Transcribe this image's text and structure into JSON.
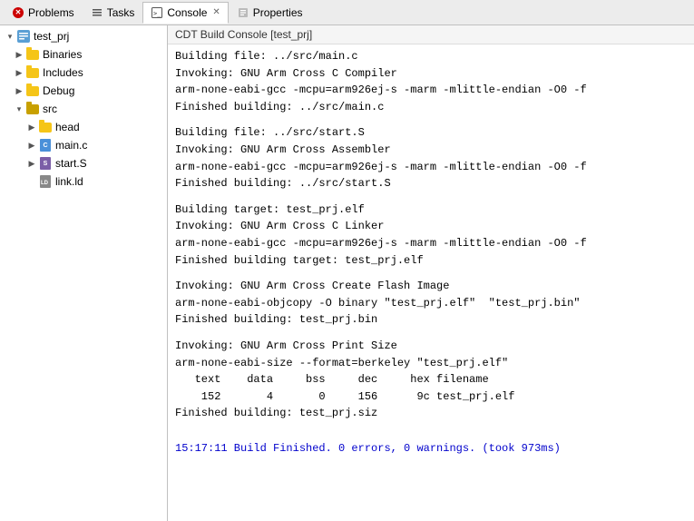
{
  "tabs": [
    {
      "id": "problems",
      "label": "Problems",
      "icon": "problems-icon",
      "active": false,
      "closable": false
    },
    {
      "id": "tasks",
      "label": "Tasks",
      "icon": "tasks-icon",
      "active": false,
      "closable": false
    },
    {
      "id": "console",
      "label": "Console",
      "icon": "console-icon",
      "active": true,
      "closable": true
    },
    {
      "id": "properties",
      "label": "Properties",
      "icon": "props-icon",
      "active": false,
      "closable": false
    }
  ],
  "console_header": "CDT Build Console [test_prj]",
  "sidebar": {
    "tree": [
      {
        "id": "test_prj",
        "label": "test_prj",
        "icon": "project",
        "indent": 0,
        "expanded": true,
        "arrow": "▾"
      },
      {
        "id": "binaries",
        "label": "Binaries",
        "icon": "folder",
        "indent": 1,
        "expanded": false,
        "arrow": "▶"
      },
      {
        "id": "includes",
        "label": "Includes",
        "icon": "folder",
        "indent": 1,
        "expanded": false,
        "arrow": "▶"
      },
      {
        "id": "debug",
        "label": "Debug",
        "icon": "folder",
        "indent": 1,
        "expanded": false,
        "arrow": "▶"
      },
      {
        "id": "src",
        "label": "src",
        "icon": "folder-src",
        "indent": 1,
        "expanded": true,
        "arrow": "▾"
      },
      {
        "id": "head",
        "label": "head",
        "icon": "folder",
        "indent": 2,
        "expanded": false,
        "arrow": "▶"
      },
      {
        "id": "main_c",
        "label": "main.c",
        "icon": "c-file",
        "indent": 2,
        "expanded": false,
        "arrow": "▶"
      },
      {
        "id": "start_s",
        "label": "start.S",
        "icon": "s-file",
        "indent": 2,
        "expanded": false,
        "arrow": "▶"
      },
      {
        "id": "link_ld",
        "label": "link.ld",
        "icon": "ld-file",
        "indent": 2,
        "expanded": false,
        "arrow": ""
      }
    ]
  },
  "console_lines": [
    {
      "text": "Building file: ../src/main.c",
      "type": "normal",
      "empty": false
    },
    {
      "text": "Invoking: GNU Arm Cross C Compiler",
      "type": "normal",
      "empty": false
    },
    {
      "text": "arm-none-eabi-gcc -mcpu=arm926ej-s -marm -mlittle-endian -O0 -f",
      "type": "normal",
      "empty": false
    },
    {
      "text": "Finished building: ../src/main.c",
      "type": "normal",
      "empty": false
    },
    {
      "text": "",
      "type": "empty",
      "empty": true
    },
    {
      "text": "Building file: ../src/start.S",
      "type": "normal",
      "empty": false
    },
    {
      "text": "Invoking: GNU Arm Cross Assembler",
      "type": "normal",
      "empty": false
    },
    {
      "text": "arm-none-eabi-gcc -mcpu=arm926ej-s -marm -mlittle-endian -O0 -f",
      "type": "normal",
      "empty": false
    },
    {
      "text": "Finished building: ../src/start.S",
      "type": "normal",
      "empty": false
    },
    {
      "text": "",
      "type": "empty",
      "empty": true
    },
    {
      "text": "Building target: test_prj.elf",
      "type": "normal",
      "empty": false
    },
    {
      "text": "Invoking: GNU Arm Cross C Linker",
      "type": "normal",
      "empty": false
    },
    {
      "text": "arm-none-eabi-gcc -mcpu=arm926ej-s -marm -mlittle-endian -O0 -f",
      "type": "normal",
      "empty": false
    },
    {
      "text": "Finished building target: test_prj.elf",
      "type": "normal",
      "empty": false
    },
    {
      "text": "",
      "type": "empty",
      "empty": true
    },
    {
      "text": "Invoking: GNU Arm Cross Create Flash Image",
      "type": "normal",
      "empty": false
    },
    {
      "text": "arm-none-eabi-objcopy -O binary \"test_prj.elf\"  \"test_prj.bin\"",
      "type": "normal",
      "empty": false
    },
    {
      "text": "Finished building: test_prj.bin",
      "type": "normal",
      "empty": false
    },
    {
      "text": "",
      "type": "empty",
      "empty": true
    },
    {
      "text": "Invoking: GNU Arm Cross Print Size",
      "type": "normal",
      "empty": false
    },
    {
      "text": "arm-none-eabi-size --format=berkeley \"test_prj.elf\"",
      "type": "normal",
      "empty": false
    },
    {
      "text": "   text    data     bss     dec     hex filename",
      "type": "normal",
      "empty": false
    },
    {
      "text": "    152       4       0     156      9c test_prj.elf",
      "type": "normal",
      "empty": false
    },
    {
      "text": "Finished building: test_prj.siz",
      "type": "normal",
      "empty": false
    },
    {
      "text": "",
      "type": "empty",
      "empty": true
    },
    {
      "text": "",
      "type": "empty",
      "empty": true
    },
    {
      "text": "15:17:11 Build Finished. 0 errors, 0 warnings. (took 973ms)",
      "type": "blue",
      "empty": false
    }
  ]
}
